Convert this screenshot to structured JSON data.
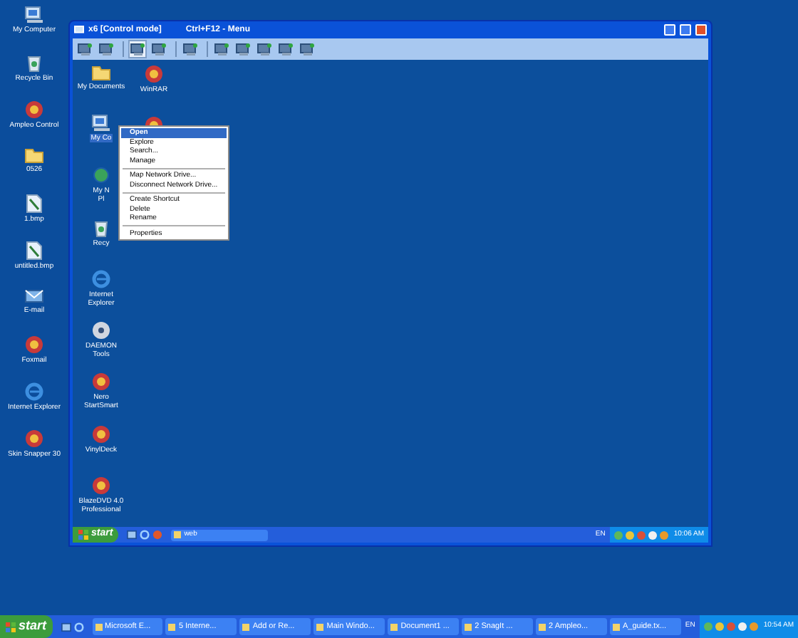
{
  "desktop_icons": [
    {
      "label": "My Computer"
    },
    {
      "label": "Recycle Bin"
    },
    {
      "label": "Ampleo Control"
    },
    {
      "label": "0526"
    },
    {
      "label": "1.bmp"
    },
    {
      "label": "untitled.bmp"
    },
    {
      "label": "E-mail"
    },
    {
      "label": "Foxmail"
    },
    {
      "label": "Internet Explorer"
    },
    {
      "label": "Skin Snapper 30"
    }
  ],
  "remote_window": {
    "title": "x6 [Control mode]",
    "hint": "Ctrl+F12 - Menu",
    "toolbar": [
      {
        "selected": false
      },
      {
        "selected": false
      },
      {
        "selected": true
      },
      {
        "selected": false
      },
      {
        "selected": false
      },
      {
        "selected": false
      },
      {
        "selected": false
      },
      {
        "selected": false
      },
      {
        "selected": false
      },
      {
        "selected": false
      }
    ],
    "desktop_column_1": [
      {
        "label": "My Documents"
      },
      {
        "label": "My Co",
        "selected": true
      },
      {
        "label": "My N\nPl",
        "selected": false
      },
      {
        "label": "Recy",
        "selected": false
      },
      {
        "label": "Internet Explorer",
        "selected": false
      },
      {
        "label": "DAEMON Tools",
        "selected": false
      },
      {
        "label": "Nero StartSmart",
        "selected": false
      },
      {
        "label": "VinylDeck",
        "selected": false
      },
      {
        "label": "BlazeDVD 4.0 Professional",
        "selected": false
      }
    ],
    "desktop_column_2": [
      {
        "label": "WinRAR"
      }
    ],
    "context_menu": [
      {
        "label": "Open",
        "selected": true
      },
      {
        "label": "Explore",
        "selected": false
      },
      {
        "label": "Search...",
        "selected": false
      },
      {
        "label": "Manage",
        "selected": false,
        "separator_after": true
      },
      {
        "label": "Map Network Drive...",
        "selected": false
      },
      {
        "label": "Disconnect Network Drive...",
        "selected": false,
        "separator_after": true
      },
      {
        "label": "Create Shortcut",
        "selected": false
      },
      {
        "label": "Delete",
        "selected": false
      },
      {
        "label": "Rename",
        "selected": false,
        "separator_after": true
      },
      {
        "label": "Properties",
        "selected": false
      }
    ],
    "taskbar": {
      "start": "start",
      "tasks": [
        "web"
      ],
      "language": "EN",
      "clock": "10:06 AM"
    }
  },
  "taskbar": {
    "start": "start",
    "tasks": [
      "Microsoft E...",
      "5 Interne...",
      "Add or Re...",
      "Main Windo...",
      "Document1 ...",
      "2 SnagIt ...",
      "2 Ampleo...",
      "A_guide.tx..."
    ],
    "language": "EN",
    "clock": "10:54 AM"
  }
}
